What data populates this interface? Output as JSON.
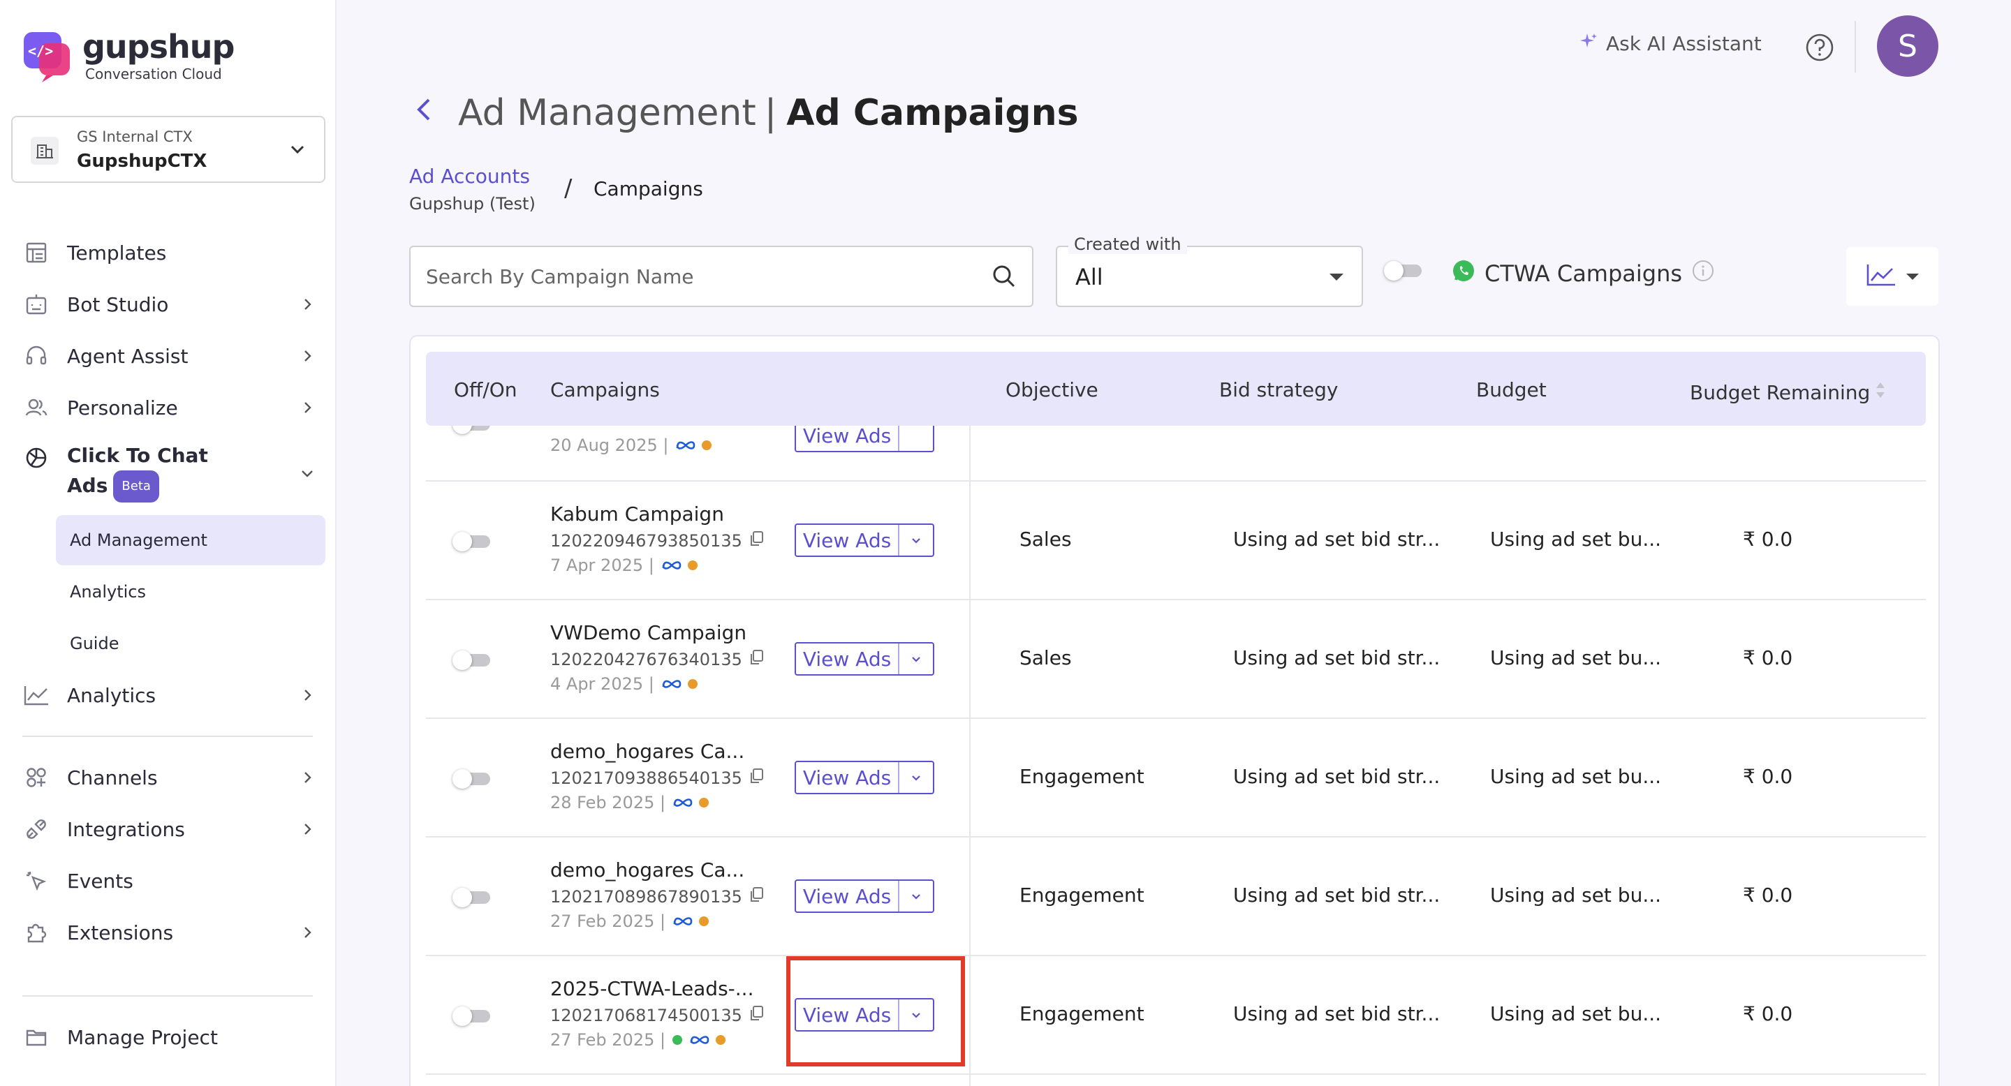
{
  "brand": {
    "name": "gupshup",
    "tagline": "Conversation Cloud"
  },
  "workspace": {
    "org": "GS Internal CTX",
    "name": "GupshupCTX"
  },
  "nav": {
    "templates": "Templates",
    "bot_studio": "Bot Studio",
    "agent_assist": "Agent Assist",
    "personalize": "Personalize",
    "click_to_chat_line1": "Click To Chat",
    "click_to_chat_line2": "Ads",
    "beta": "Beta",
    "sub_ad_management": "Ad Management",
    "sub_analytics": "Analytics",
    "sub_guide": "Guide",
    "analytics": "Analytics",
    "channels": "Channels",
    "integrations": "Integrations",
    "events": "Events",
    "extensions": "Extensions",
    "manage_project": "Manage Project"
  },
  "topbar": {
    "ask_ai": "Ask AI Assistant",
    "avatar_initial": "S"
  },
  "page": {
    "title_part1": "Ad Management",
    "title_sep": "|",
    "title_part2": "Ad Campaigns",
    "breadcrumb_link": "Ad Accounts",
    "breadcrumb_sub": "Gupshup (Test)",
    "breadcrumb_sep": "/",
    "breadcrumb_current": "Campaigns"
  },
  "filters": {
    "search_placeholder": "Search By Campaign Name",
    "created_with_label": "Created with",
    "created_with_value": "All",
    "ctwa_label": "CTWA Campaigns"
  },
  "table": {
    "headers": {
      "off_on": "Off/On",
      "campaigns": "Campaigns",
      "objective": "Objective",
      "bid_strategy": "Bid strategy",
      "budget": "Budget",
      "budget_remaining": "Budget Remaining"
    },
    "view_ads_label": "View Ads",
    "partial_row": {
      "date": "20 Aug 2025 |"
    },
    "rows": [
      {
        "name": "Kabum Campaign",
        "id": "120220946793850135",
        "date": "7 Apr 2025 |",
        "objective": "Sales",
        "bid": "Using ad set bid str...",
        "budget": "Using ad set bu...",
        "remaining": "₹ 0.0",
        "whatsapp": false
      },
      {
        "name": "VWDemo Campaign",
        "id": "120220427676340135",
        "date": "4 Apr 2025 |",
        "objective": "Sales",
        "bid": "Using ad set bid str...",
        "budget": "Using ad set bu...",
        "remaining": "₹ 0.0",
        "whatsapp": false
      },
      {
        "name": "demo_hogares Ca...",
        "id": "120217093886540135",
        "date": "28 Feb 2025 |",
        "objective": "Engagement",
        "bid": "Using ad set bid str...",
        "budget": "Using ad set bu...",
        "remaining": "₹ 0.0",
        "whatsapp": false
      },
      {
        "name": "demo_hogares Ca...",
        "id": "120217089867890135",
        "date": "27 Feb 2025 |",
        "objective": "Engagement",
        "bid": "Using ad set bid str...",
        "budget": "Using ad set bu...",
        "remaining": "₹ 0.0",
        "whatsapp": false
      },
      {
        "name": "2025-CTWA-Leads-...",
        "id": "120217068174500135",
        "date": "27 Feb 2025 |",
        "objective": "Engagement",
        "bid": "Using ad set bid str...",
        "budget": "Using ad set bu...",
        "remaining": "₹ 0.0",
        "whatsapp": true
      }
    ]
  },
  "colors": {
    "accent": "#5a4fcf",
    "header_bg": "#e8e6fb",
    "highlight": "#e23b2a",
    "avatar": "#7b56a8"
  }
}
